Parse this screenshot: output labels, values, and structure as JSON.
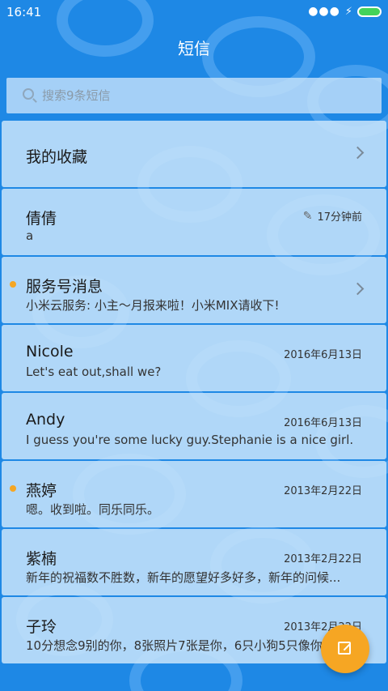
{
  "status_bar": {
    "time": "16:41",
    "icons": [
      "more-dots-icon",
      "charging-bolt-icon",
      "battery-icon"
    ],
    "battery_color": "#43d35a"
  },
  "header": {
    "title": "短信"
  },
  "search": {
    "placeholder": "搜索9条短信"
  },
  "favorites": {
    "label": "我的收藏"
  },
  "conversations": [
    {
      "name": "倩倩",
      "preview": "a",
      "time": "17分钟前",
      "draft": true,
      "unread": false
    },
    {
      "name": "服务号消息",
      "preview": "小米云服务: 小主～月报来啦！小米MIX请收下!",
      "time": "",
      "unread": true,
      "has_chevron": true
    },
    {
      "name": "Nicole",
      "preview": "Let's eat out,shall we?",
      "time": "2016年6月13日",
      "unread": false
    },
    {
      "name": "Andy",
      "preview": "I guess you're some lucky guy.Stephanie is a nice girl.",
      "time": "2016年6月13日",
      "unread": false
    },
    {
      "name": "燕婷",
      "preview": "嗯。收到啦。同乐同乐。",
      "time": "2013年2月22日",
      "unread": true
    },
    {
      "name": "紫楠",
      "preview": "新年的祝福数不胜数，新年的愿望好多好多，新年的问候...",
      "time": "2013年2月22日",
      "unread": false
    },
    {
      "name": "子玲",
      "preview": "10分想念9别的你，8张照片7张是你，6只小狗5只像你",
      "time": "2013年2月22日",
      "unread": false
    }
  ],
  "fab": {
    "icon": "compose-icon",
    "color": "#f6a623"
  },
  "colors": {
    "background": "#1e88e5",
    "unread_dot": "#f5a623"
  }
}
